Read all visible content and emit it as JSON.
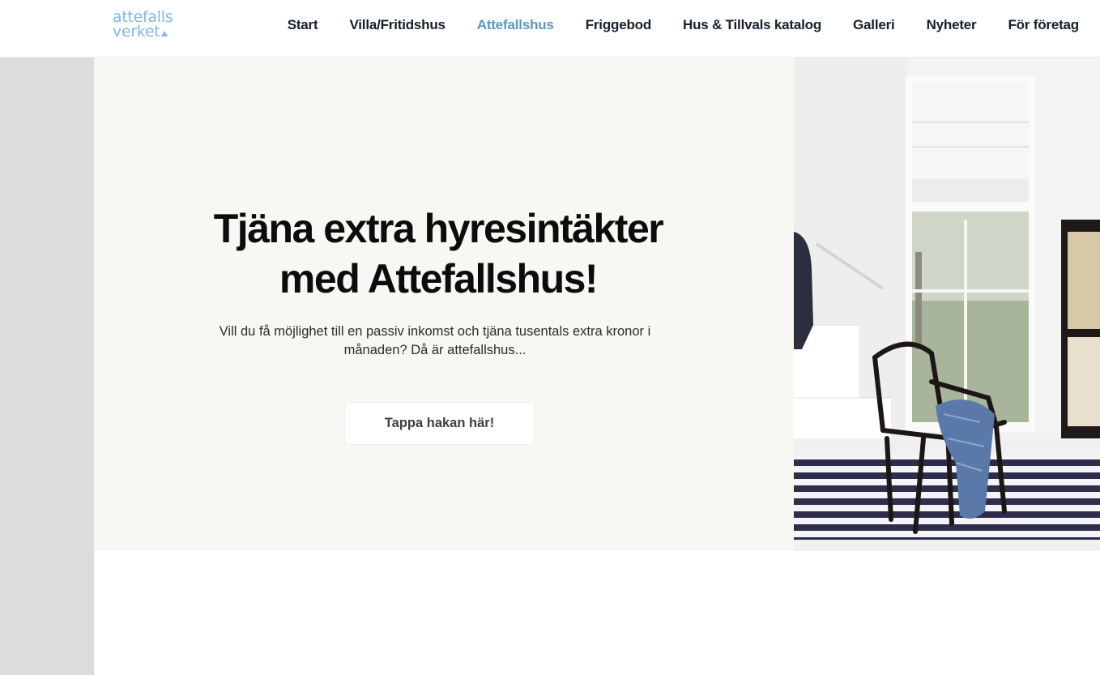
{
  "logo": {
    "line1": "attefalls",
    "line2": "verket"
  },
  "nav": {
    "items": [
      {
        "label": "Start",
        "active": false
      },
      {
        "label": "Villa/Fritidshus",
        "active": false
      },
      {
        "label": "Attefallshus",
        "active": true
      },
      {
        "label": "Friggebod",
        "active": false
      },
      {
        "label": "Hus & Tillvals katalog",
        "active": false
      },
      {
        "label": "Galleri",
        "active": false
      },
      {
        "label": "Nyheter",
        "active": false
      },
      {
        "label": "För företag",
        "active": false
      }
    ]
  },
  "hero": {
    "title_line1": "Tjäna extra hyresintäkter",
    "title_line2": "med Attefallshus!",
    "text": "Vill du få möjlighet till en passiv inkomst och tjäna tusentals extra kronor i månaden? Då är attefallshus...",
    "button_label": "Tappa hakan här!"
  },
  "colors": {
    "accent": "#5a97c4",
    "logo": "#7fb8e0",
    "hero_bg": "#f8f7f4",
    "gutter": "#dcdcdc"
  }
}
